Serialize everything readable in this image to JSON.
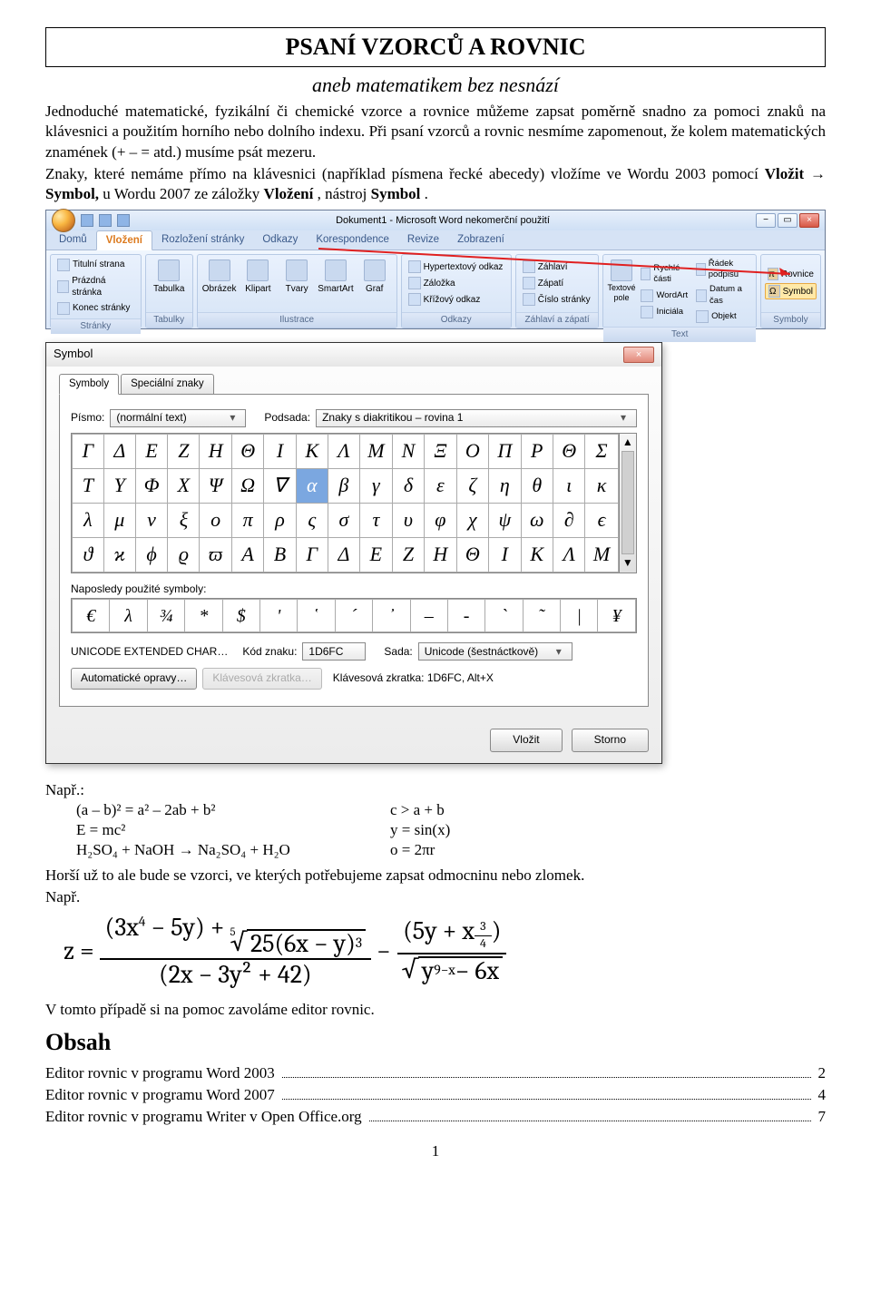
{
  "title": "PSANÍ VZORCŮ A ROVNIC",
  "subtitle": "aneb matematikem bez nesnází",
  "para1": "Jednoduché matematické, fyzikální či chemické vzorce a rovnice můžeme zapsat poměrně snadno za pomoci znaků na klávesnici a použitím horního nebo dolního indexu. Při psaní vzorců a rovnic nesmíme zapomenout, že kolem matematických znamének (+ – = atd.) musíme psát mezeru.",
  "para2_a": "Znaky, které nemáme přímo na klávesnici (například písmena řecké abecedy) vložíme ve Wordu 2003 pomocí ",
  "para2_b": "Vložit → Symbol, ",
  "para2_c": "u Wordu 2007 ze záložky ",
  "para2_d": "Vložení",
  "para2_e": ", nástroj ",
  "para2_f": "Symbol",
  "para2_g": ".",
  "word": {
    "doc_title": "Dokument1 - Microsoft Word nekomerční použití",
    "tabs": [
      "Domů",
      "Vložení",
      "Rozložení stránky",
      "Odkazy",
      "Korespondence",
      "Revize",
      "Zobrazení"
    ],
    "active_tab": 1,
    "groups": {
      "stranky": {
        "title": "Stránky",
        "items": [
          "Titulní strana",
          "Prázdná stránka",
          "Konec stránky"
        ]
      },
      "tabulky": {
        "title": "Tabulky",
        "btn": "Tabulka"
      },
      "ilustrace": {
        "title": "Ilustrace",
        "btns": [
          "Obrázek",
          "Klipart",
          "Tvary",
          "SmartArt",
          "Graf"
        ]
      },
      "odkazy": {
        "title": "Odkazy",
        "items": [
          "Hypertextový odkaz",
          "Záložka",
          "Křížový odkaz"
        ]
      },
      "zahlavi": {
        "title": "Záhlaví a zápatí",
        "items": [
          "Záhlaví",
          "Zápatí",
          "Číslo stránky"
        ]
      },
      "text": {
        "title": "Text",
        "btn": "Textové pole",
        "items": [
          "Rychlé části",
          "WordArt",
          "Iniciála",
          "Řádek podpisu",
          "Datum a čas",
          "Objekt"
        ]
      },
      "symboly": {
        "title": "Symboly",
        "items": [
          "Rovnice",
          "Symbol"
        ]
      }
    }
  },
  "symdlg": {
    "title": "Symbol",
    "tab_symboly": "Symboly",
    "tab_spec": "Speciální znaky",
    "lbl_pismo": "Písmo:",
    "val_pismo": "(normální text)",
    "lbl_podsada": "Podsada:",
    "val_podsada": "Znaky s diakritikou – rovina 1",
    "grid": [
      [
        "Γ",
        "Δ",
        "Ε",
        "Ζ",
        "Η",
        "Θ",
        "Ι",
        "Κ",
        "Λ",
        "Μ",
        "Ν",
        "Ξ",
        "Ο",
        "Π",
        "Ρ",
        "Θ",
        "Σ"
      ],
      [
        "Τ",
        "Υ",
        "Φ",
        "Χ",
        "Ψ",
        "Ω",
        "∇",
        "α",
        "β",
        "γ",
        "δ",
        "ε",
        "ζ",
        "η",
        "θ",
        "ι",
        "κ"
      ],
      [
        "λ",
        "μ",
        "ν",
        "ξ",
        "ο",
        "π",
        "ρ",
        "ς",
        "σ",
        "τ",
        "υ",
        "φ",
        "χ",
        "ψ",
        "ω",
        "∂",
        "ϵ"
      ],
      [
        "ϑ",
        "ϰ",
        "ϕ",
        "ϱ",
        "ϖ",
        "Α",
        "Β",
        "Γ",
        "Δ",
        "Ε",
        "Ζ",
        "Η",
        "Θ",
        "Ι",
        "Κ",
        "Λ",
        "Μ"
      ]
    ],
    "selected": {
      "row": 1,
      "col": 7
    },
    "recent_lbl": "Naposledy použité symboly:",
    "recent": [
      "€",
      "λ",
      "¾",
      "*",
      "$",
      "'",
      "῾",
      "´",
      "᾽",
      "–",
      "-",
      "`",
      "῀",
      "|",
      "¥"
    ],
    "enc": "UNICODE EXTENDED CHAR…",
    "lbl_kod": "Kód znaku:",
    "val_kod": "1D6FC",
    "lbl_sada": "Sada:",
    "val_sada": "Unicode (šestnáctkově)",
    "btn_auto": "Automatické opravy…",
    "btn_key": "Klávesová zkratka…",
    "lbl_shortcut": "Klávesová zkratka: 1D6FC, Alt+X",
    "btn_insert": "Vložit",
    "btn_cancel": "Storno"
  },
  "examples": {
    "napr": "Např.:",
    "l1": "(a – b)² = a² – 2ab + b²",
    "r1": "c > a + b",
    "l2": "E = mc²",
    "r2": "y = sin(x)",
    "l3": "H₂SO₄ + NaOH → Na₂SO₄ + H₂O",
    "r3": "o = 2πr",
    "after": "Horší už to ale bude se vzorci, ve kterých potřebujeme zapsat odmocninu nebo zlomek.",
    "napr2": "Např."
  },
  "bigeq": {
    "z": "z =",
    "num1_a": "(3x",
    "num1_b": " − 5y) + ",
    "num1_root_deg": "5",
    "num1_root_body": "25(6x − y)",
    "num1_root_exp": "3",
    "den1": "(2x − 3y² + 42)",
    "minus": " − ",
    "num2_a": "(5y + x",
    "num2_exp_num": "3",
    "num2_exp_den": "4",
    "num2_b": ")",
    "den2_root_body": "y",
    "den2_root_exp": "9−x",
    "den2_tail": " − 6x"
  },
  "closing": "V tomto případě si na pomoc zavoláme editor rovnic.",
  "obsah": "Obsah",
  "toc": [
    {
      "label": "Editor rovnic v programu Word 2003",
      "page": "2"
    },
    {
      "label": "Editor rovnic v programu Word 2007",
      "page": "4"
    },
    {
      "label": "Editor rovnic v programu Writer v Open Office.org",
      "page": "7"
    }
  ],
  "page_number": "1"
}
